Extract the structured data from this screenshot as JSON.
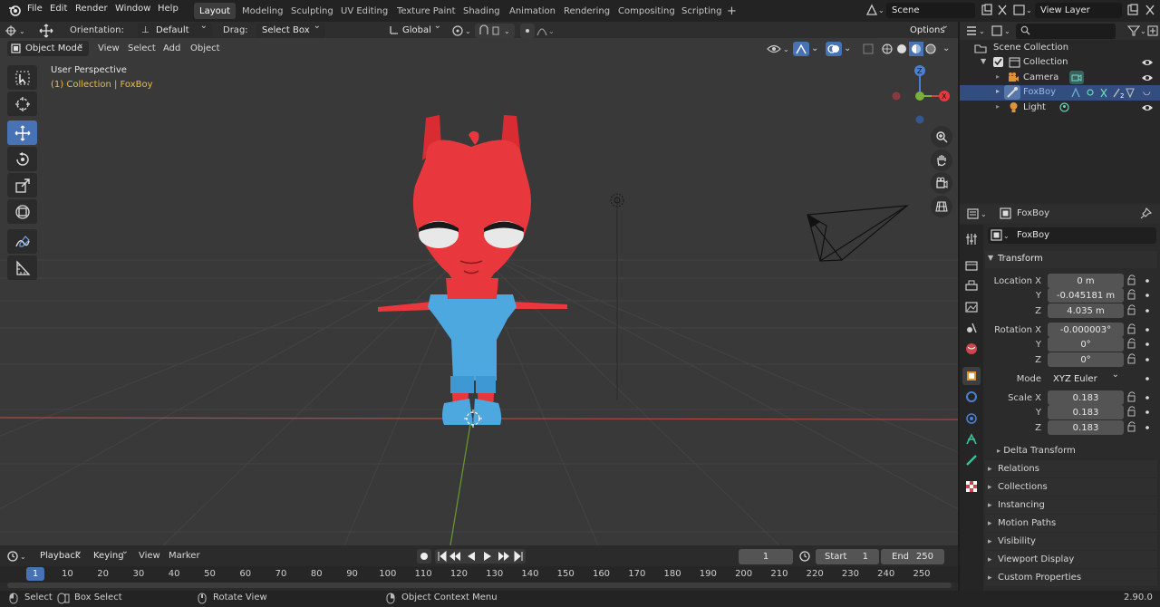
{
  "app": {
    "version": "2.90.0"
  },
  "topbar": {
    "menus": [
      "File",
      "Edit",
      "Render",
      "Window",
      "Help"
    ],
    "workspaces": [
      "Layout",
      "Modeling",
      "Sculpting",
      "UV Editing",
      "Texture Paint",
      "Shading",
      "Animation",
      "Rendering",
      "Compositing",
      "Scripting"
    ],
    "add_tab": "+",
    "scene": "Scene",
    "view_layer": "View Layer"
  },
  "tool_header": {
    "orientation_label": "Orientation:",
    "orientation_value": "Default",
    "drag_label": "Drag:",
    "drag_value": "Select Box",
    "transform_orientation": "Global",
    "options": "Options"
  },
  "viewport_header": {
    "mode": "Object Mode",
    "menus": [
      "View",
      "Select",
      "Add",
      "Object"
    ]
  },
  "viewport": {
    "perspective": "User Perspective",
    "context": "(1) Collection | FoxBoy",
    "gizmo_axes": [
      "X",
      "Y",
      "Z"
    ]
  },
  "outliner": {
    "search_placeholder": "",
    "items": [
      {
        "label": "Scene Collection"
      },
      {
        "label": "Collection"
      },
      {
        "label": "Camera"
      },
      {
        "label": "FoxBoy"
      },
      {
        "label": "Light"
      }
    ]
  },
  "properties": {
    "object_name": "FoxBoy",
    "datablock": "FoxBoy",
    "transform_title": "Transform",
    "location_label": "Location X",
    "rotation_label": "Rotation X",
    "scale_label": "Scale X",
    "axis_y": "Y",
    "axis_z": "Z",
    "location": [
      "0 m",
      "-0.045181 m",
      "4.035 m"
    ],
    "rotation": [
      "-0.000003°",
      "0°",
      "0°"
    ],
    "mode_label": "Mode",
    "mode_value": "XYZ Euler",
    "scale": [
      "0.183",
      "0.183",
      "0.183"
    ],
    "delta_transform": "Delta Transform",
    "panels": [
      "Relations",
      "Collections",
      "Instancing",
      "Motion Paths",
      "Visibility",
      "Viewport Display",
      "Custom Properties"
    ]
  },
  "timeline": {
    "menus": [
      "Playback",
      "Keying",
      "View",
      "Marker"
    ],
    "current_frame": "1",
    "start_label": "Start",
    "start_value": "1",
    "end_label": "End",
    "end_value": "250",
    "frame_ticks": [
      "1",
      "10",
      "20",
      "30",
      "40",
      "50",
      "60",
      "70",
      "80",
      "90",
      "100",
      "110",
      "120",
      "130",
      "140",
      "150",
      "160",
      "170",
      "180",
      "190",
      "200",
      "210",
      "220",
      "230",
      "240",
      "250"
    ]
  },
  "statusbar": {
    "select": "Select",
    "box_select": "Box Select",
    "rotate_view": "Rotate View",
    "context_menu": "Object Context Menu"
  },
  "colors": {
    "accent": "#4772b3",
    "viewport_bg": "#393939",
    "character_head": "#e8383d",
    "character_body": "#4da8e0",
    "axis_x": "#c84848",
    "axis_y": "#7bb03a",
    "axis_z": "#4a80d4",
    "context_text": "#e6c23a"
  }
}
